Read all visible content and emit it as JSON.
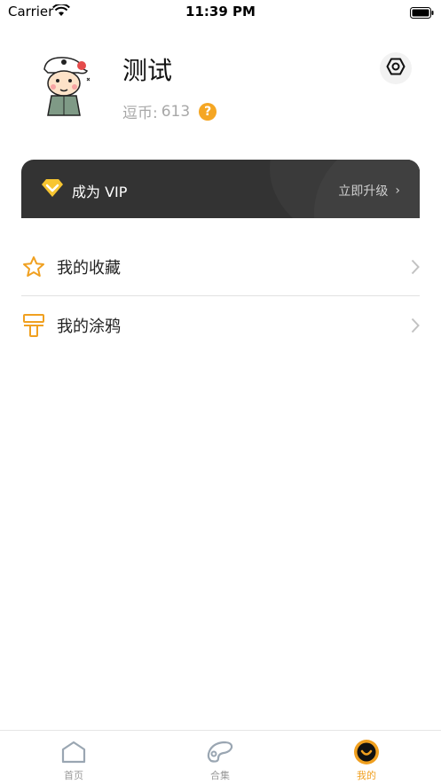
{
  "status_bar": {
    "carrier": "Carrier",
    "time": "11:39 PM"
  },
  "profile": {
    "name": "测试",
    "coins_label": "逗币:",
    "coins_value": "613",
    "help_symbol": "?"
  },
  "vip": {
    "title": "成为 VIP",
    "upgrade_label": "立即升级",
    "upgrade_chevron": "›"
  },
  "menu": [
    {
      "label": "我的收藏",
      "icon": "star-icon"
    },
    {
      "label": "我的涂鸦",
      "icon": "paint-roller-icon"
    }
  ],
  "tabs": [
    {
      "label": "首页",
      "icon": "home-icon",
      "active": false
    },
    {
      "label": "合集",
      "icon": "palette-icon",
      "active": false
    },
    {
      "label": "我的",
      "icon": "smile-icon",
      "active": true
    }
  ],
  "colors": {
    "accent": "#f0a020",
    "vip_bg": "#333333",
    "help": "#f5a623"
  }
}
